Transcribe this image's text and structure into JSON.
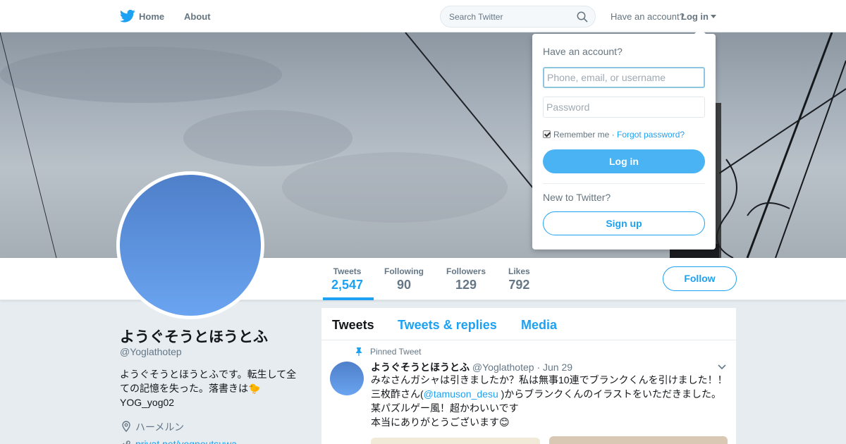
{
  "nav": {
    "home_label": "Home",
    "about_label": "About",
    "search_placeholder": "Search Twitter",
    "have_account": "Have an account?",
    "login_label": "Log in"
  },
  "profile_nav": {
    "stats": [
      {
        "label": "Tweets",
        "value": "2,547"
      },
      {
        "label": "Following",
        "value": "90"
      },
      {
        "label": "Followers",
        "value": "129"
      },
      {
        "label": "Likes",
        "value": "792"
      }
    ],
    "follow_label": "Follow"
  },
  "profile": {
    "display_name": "ようぐそうとほうとふ",
    "screen_name": "@Yoglathotep",
    "bio": "ようぐそうとほうとふです。転生して全ての記憶を失った。落書きは🐤 YOG_yog02",
    "location": "ハーメルン",
    "url": "privat.net/yognoutsuwa"
  },
  "timeline": {
    "tabs": [
      "Tweets",
      "Tweets & replies",
      "Media"
    ],
    "pinned_label": "Pinned Tweet",
    "tweet": {
      "name": "ようぐそうとほうとふ",
      "handle": "@Yoglathotep",
      "date": "· Jun 29",
      "line1": "みなさんガシャは引きましたか？私は無事10連でブランクくんを引けました！！",
      "line2_pre": "三枚酢さん(",
      "line2_link": "@tamuson_desu",
      "line2_post": " )からブランクくんのイラストをいただきました。",
      "line3": "某パズルゲー風！超かわいいです",
      "line4": "本当にありがとうございます😊"
    }
  },
  "login_dropdown": {
    "title": "Have an account?",
    "username_placeholder": "Phone, email, or username",
    "password_placeholder": "Password",
    "remember_label": "Remember me",
    "separator": " · ",
    "forgot_label": "Forgot password?",
    "login_button": "Log in",
    "new_label": "New to Twitter?",
    "signup_button": "Sign up"
  },
  "colors": {
    "accent": "#1da1f2",
    "login_button": "#4ab3f4",
    "avatar": "#5a8fdc"
  }
}
